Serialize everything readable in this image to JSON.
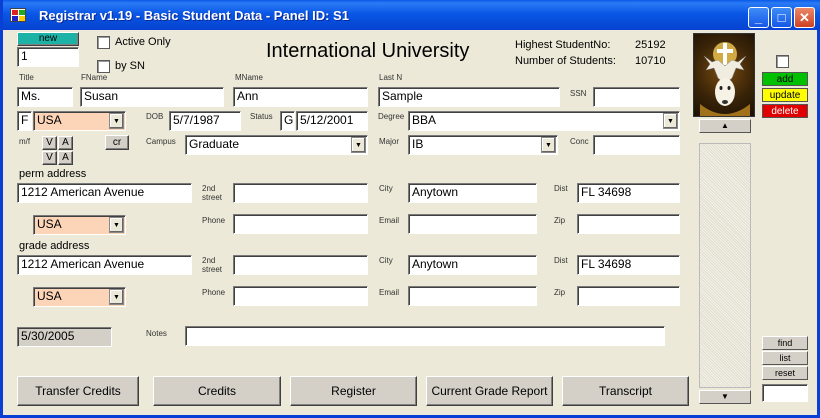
{
  "window": {
    "title": "Registrar  v1.19 - Basic Student Data - Panel ID: S1",
    "minimize_glyph": "_",
    "maximize_glyph": "□",
    "close_glyph": "✕"
  },
  "header": {
    "new_label": "new",
    "record_number": "1",
    "active_only_label": "Active Only",
    "by_ssn_label": "by SN",
    "university_name": "International University",
    "highest_student_label": "Highest StudentNo:",
    "highest_student_value": "25192",
    "num_students_label": "Number of Students:",
    "num_students_value": "10710"
  },
  "labels": {
    "title": "Title",
    "fname": "FName",
    "mname": "MName",
    "lastn": "Last N",
    "ssn": "SSN",
    "dob": "DOB",
    "status": "Status",
    "degree": "Degree",
    "mf": "m/f",
    "campus": "Campus",
    "major": "Major",
    "conc": "Conc",
    "perm_address": "perm address",
    "second_street": "2nd street",
    "city": "City",
    "dist": "Dist",
    "phone": "Phone",
    "email": "Email",
    "zip": "Zip",
    "grade_address": "grade address",
    "notes": "Notes"
  },
  "student": {
    "title": "Ms.",
    "fname": "Susan",
    "mname": "Ann",
    "lastn": "Sample",
    "ssn": "",
    "gender": "F",
    "country": "USA",
    "dob": "5/7/1987",
    "status_code": "G",
    "status_date": "5/12/2001",
    "degree": "BBA",
    "campus": "Graduate",
    "major": "IB",
    "conc": "",
    "v_label": "V",
    "a_label": "A",
    "cr_label": "cr"
  },
  "perm_address": {
    "street": "1212 American Avenue",
    "street2": "",
    "city": "Anytown",
    "dist": "FL 34698",
    "country": "USA",
    "phone": "",
    "email": "",
    "zip": ""
  },
  "grade_address": {
    "street": "1212 American Avenue",
    "street2": "",
    "city": "Anytown",
    "dist": "FL  34698",
    "country": "USA",
    "phone": "",
    "email": "",
    "zip": ""
  },
  "footer": {
    "date": "5/30/2005",
    "notes": ""
  },
  "side_buttons": {
    "add": "add",
    "update": "update",
    "delete": "delete",
    "find": "find",
    "list": "list",
    "reset": "reset"
  },
  "bottom_buttons": [
    "Transfer Credits",
    "Credits",
    "Register",
    "Current Grade Report",
    "Transcript"
  ],
  "colors": {
    "new_button": "#1cb2a6",
    "add_button": "#00c000",
    "update_button": "#ffff00",
    "delete_button": "#e00000",
    "country_field": "#fcd5b8"
  }
}
